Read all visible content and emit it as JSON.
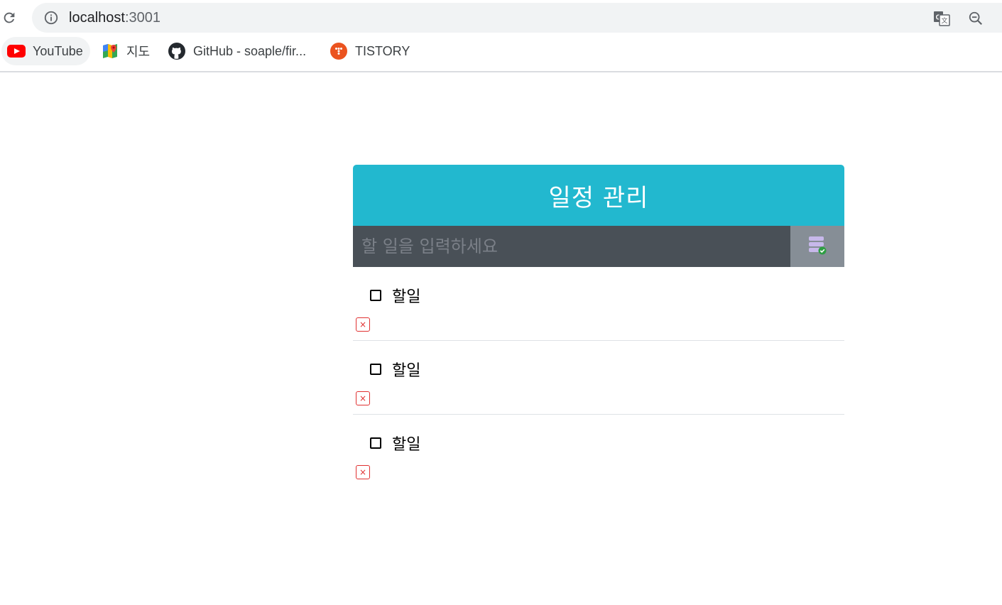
{
  "browser": {
    "url_host": "localhost",
    "url_port": ":3001",
    "bookmarks": [
      {
        "label": "YouTube",
        "icon": "youtube-icon"
      },
      {
        "label": "지도",
        "icon": "maps-icon"
      },
      {
        "label": "GitHub - soaple/fir...",
        "icon": "github-icon"
      },
      {
        "label": "TISTORY",
        "icon": "tistory-icon"
      }
    ]
  },
  "app": {
    "title": "일정 관리",
    "input_placeholder": "할 일을 입력하세요",
    "submit_icon": "database-check-icon",
    "todos": [
      {
        "text": "할일",
        "checked": false
      },
      {
        "text": "할일",
        "checked": false
      },
      {
        "text": "할일",
        "checked": false
      }
    ],
    "remove_glyph": "×"
  },
  "colors": {
    "header": "#22b8cf",
    "input_bg": "#495057",
    "button_bg": "#868e96",
    "remove": "#e03131"
  }
}
